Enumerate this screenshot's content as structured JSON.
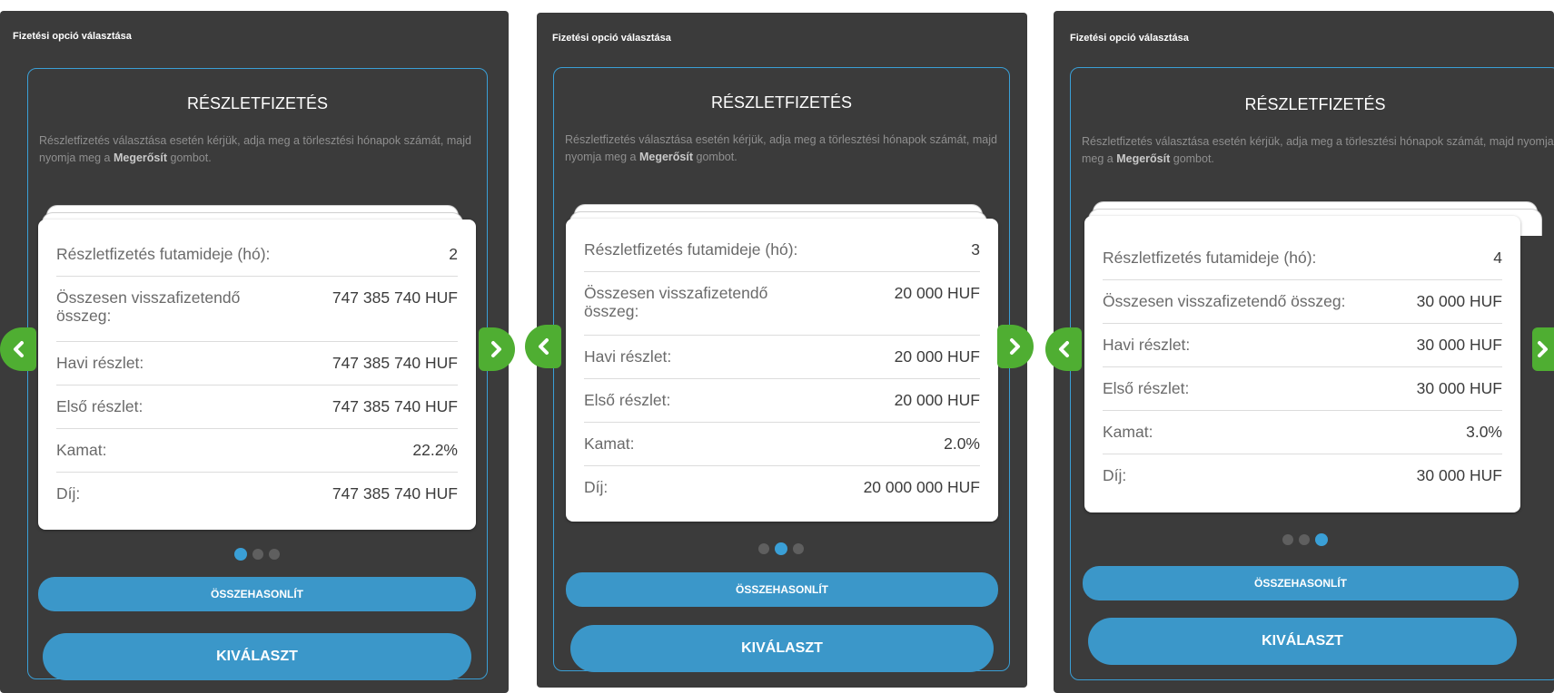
{
  "panel_title": "Fizetési opció választása",
  "section_title": "RÉSZLETFIZETÉS",
  "description": {
    "text_before": "Részletfizetés választása esetén kérjük, adja meg a törlesztési hónapok számát, majd nyomja meg a ",
    "bold": "Megerősít",
    "text_after": " gombot."
  },
  "labels": {
    "term": "Részletfizetés futamideje (hó):",
    "total": "Összesen visszafizetendő összeg:",
    "monthly": "Havi részlet:",
    "first": "Első részlet:",
    "interest": "Kamat:",
    "fee": "Díj:"
  },
  "buttons": {
    "compare": "ÖSSZEHASONLÍT",
    "select": "KIVÁLASZT"
  },
  "icons": {
    "prev": "chevron-left-icon",
    "next": "chevron-right-icon"
  },
  "colors": {
    "panel_bg": "#3b3b3b",
    "accent_blue": "#3b97c9",
    "arrow_green": "#4fae32"
  },
  "options": [
    {
      "term": "2",
      "total": "747 385 740 HUF",
      "monthly": "747 385 740 HUF",
      "first": "747 385 740 HUF",
      "interest": "22.2%",
      "fee": "747 385 740 HUF",
      "active_page": 1
    },
    {
      "term": "3",
      "total": "20 000 HUF",
      "monthly": "20 000 HUF",
      "first": "20 000 HUF",
      "interest": "2.0%",
      "fee": "20 000 000 HUF",
      "active_page": 2
    },
    {
      "term": "4",
      "total": "30 000 HUF",
      "monthly": "30 000 HUF",
      "first": "30 000 HUF",
      "interest": "3.0%",
      "fee": "30 000 HUF",
      "active_page": 3
    }
  ],
  "page_count": 3
}
